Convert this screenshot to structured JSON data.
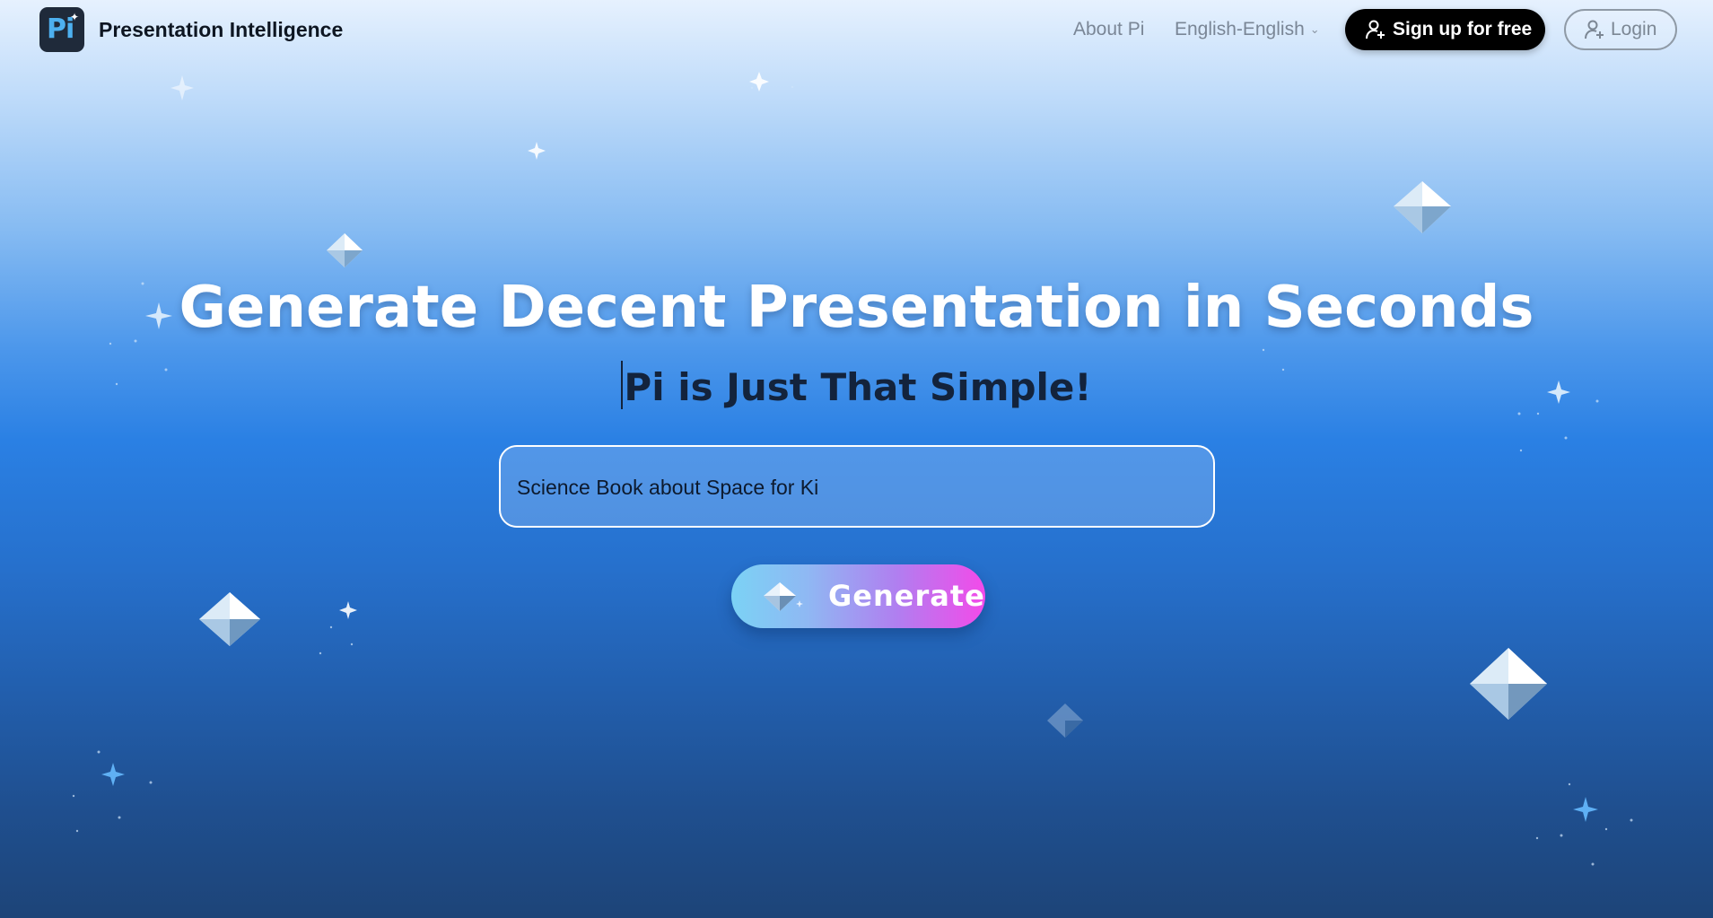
{
  "header": {
    "brand": "Presentation Intelligence",
    "logo_text": "Pi",
    "nav": {
      "about": "About Pi",
      "language": "English-English"
    },
    "signup_label": "Sign up for free",
    "login_label": "Login"
  },
  "hero": {
    "title": "Generate Decent Presentation in Seconds",
    "subtitle": "Pi is Just That Simple!"
  },
  "prompt": {
    "value": "Science Book about Space for Ki"
  },
  "generate_label": "Generate",
  "icons": {
    "logo": "pi-logo-icon",
    "signup": "user-plus-icon",
    "login": "user-plus-icon",
    "language": "chevron-down-icon",
    "generate": "diamond-icon"
  },
  "colors": {
    "signup_bg": "#000000",
    "generate_gradient_start": "#7bd2f5",
    "generate_gradient_end": "#f34ae9",
    "title_text": "#ffffff",
    "subtitle_text": "#13233c"
  }
}
